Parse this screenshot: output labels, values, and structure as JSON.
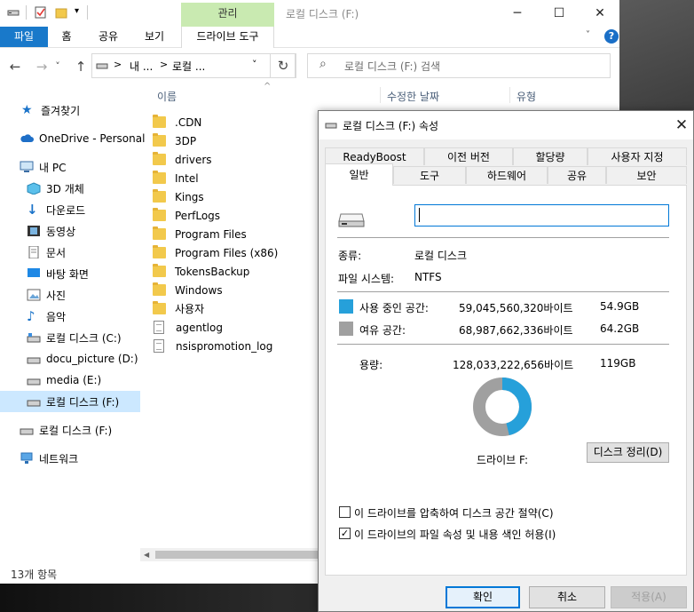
{
  "colors": {
    "accent": "#0078d7",
    "file_tab": "#1979ca",
    "context_tab": "#c9eab1",
    "used_space": "#26a0da",
    "free_space": "#a0a0a0",
    "selected_nav": "#cce8ff"
  },
  "titlebar": {
    "context_tab_label": "관리",
    "title": "로컬 디스크 (F:)",
    "minimize_icon": "─",
    "maximize_icon": "☐",
    "close_icon": "✕"
  },
  "ribbon": {
    "file": "파일",
    "home": "홈",
    "share": "공유",
    "view": "보기",
    "drive_tools": "드라이브 도구",
    "help": "?",
    "collapse_icon": "˅"
  },
  "nav": {
    "back": "←",
    "forward": "→",
    "recent": "˅",
    "up": "↑",
    "address_parts": [
      "내 ...",
      "로컬 ..."
    ],
    "address_sep": ">",
    "address_dropdown": "˅",
    "refresh": "↻",
    "search_placeholder": "로컬 디스크 (F:) 검색",
    "search_icon": "⌕"
  },
  "sidebar": {
    "quick_access": "즐겨찾기",
    "onedrive": "OneDrive - Personal",
    "this_pc": "내 PC",
    "items": [
      "3D 개체",
      "다운로드",
      "동영상",
      "문서",
      "바탕 화면",
      "사진",
      "음악",
      "로컬 디스크 (C:)",
      "docu_picture (D:)",
      "media (E:)",
      "로컬 디스크 (F:)"
    ],
    "drive_f": "로컬 디스크 (F:)",
    "network": "네트워크"
  },
  "filelist": {
    "columns": [
      "이름",
      "수정한 날짜",
      "유형"
    ],
    "sort_icon": "^",
    "folders": [
      ".CDN",
      "3DP",
      "drivers",
      "Intel",
      "Kings",
      "PerfLogs",
      "Program Files",
      "Program Files (x86)",
      "TokensBackup",
      "Windows",
      "사용자"
    ],
    "files": [
      "agentlog",
      "nsispromotion_log"
    ]
  },
  "status": {
    "item_count": "13개 항목"
  },
  "dialog": {
    "title": "로컬 디스크 (F:) 속성",
    "close_icon": "✕",
    "tabs_row1": [
      "ReadyBoost",
      "이전 버전",
      "할당량",
      "사용자 지정"
    ],
    "tabs_row2": [
      "일반",
      "도구",
      "하드웨어",
      "공유",
      "보안"
    ],
    "name_value": "",
    "type_label": "종류:",
    "type_value": "로컬 디스크",
    "fs_label": "파일 시스템:",
    "fs_value": "NTFS",
    "used_label": "사용 중인 공간:",
    "used_bytes": "59,045,560,320바이트",
    "used_gb": "54.9GB",
    "free_label": "여유 공간:",
    "free_bytes": "68,987,662,336바이트",
    "free_gb": "64.2GB",
    "capacity_label": "용량:",
    "capacity_bytes": "128,033,222,656바이트",
    "capacity_gb": "119GB",
    "used_fraction": 0.461,
    "drive_label": "드라이브 F:",
    "cleanup_button": "디스크 정리(D)",
    "compress_label": "이 드라이브를 압축하여 디스크 공간 절약(C)",
    "compress_checked": false,
    "index_label": "이 드라이브의 파일 속성 및 내용 색인 허용(I)",
    "index_checked": true,
    "check_mark": "✓",
    "ok": "확인",
    "cancel": "취소",
    "apply": "적용(A)"
  }
}
